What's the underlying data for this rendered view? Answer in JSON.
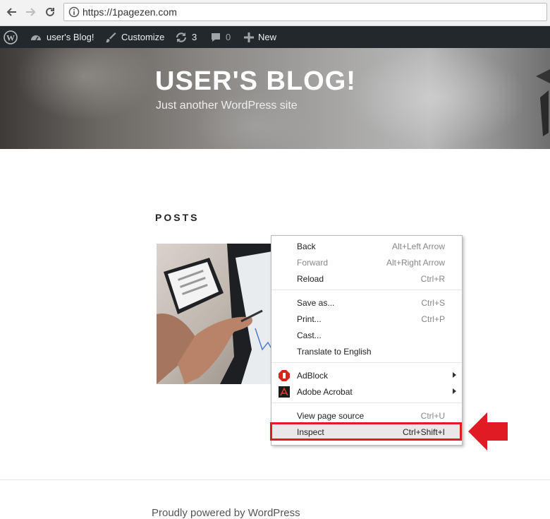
{
  "browser": {
    "url": "https://1pagezen.com"
  },
  "adminbar": {
    "site_name": "user's Blog!",
    "customize": "Customize",
    "updates_count": "3",
    "comments_count": "0",
    "new_label": "New"
  },
  "header": {
    "title": "USER'S BLOG!",
    "description": "Just another WordPress site"
  },
  "main": {
    "posts_heading": "POSTS"
  },
  "footer": {
    "text": "Proudly powered by WordPress"
  },
  "context_menu": {
    "items": [
      {
        "label": "Back",
        "shortcut": "Alt+Left Arrow"
      },
      {
        "label": "Forward",
        "shortcut": "Alt+Right Arrow"
      },
      {
        "label": "Reload",
        "shortcut": "Ctrl+R"
      },
      {
        "label": "Save as...",
        "shortcut": "Ctrl+S"
      },
      {
        "label": "Print...",
        "shortcut": "Ctrl+P"
      },
      {
        "label": "Cast..."
      },
      {
        "label": "Translate to English"
      },
      {
        "label": "AdBlock"
      },
      {
        "label": "Adobe Acrobat"
      },
      {
        "label": "View page source",
        "shortcut": "Ctrl+U"
      },
      {
        "label": "Inspect",
        "shortcut": "Ctrl+Shift+I"
      }
    ]
  },
  "colors": {
    "highlight_border": "#e01b24",
    "arrow": "#e01b24",
    "adminbar_bg": "#23282d"
  }
}
